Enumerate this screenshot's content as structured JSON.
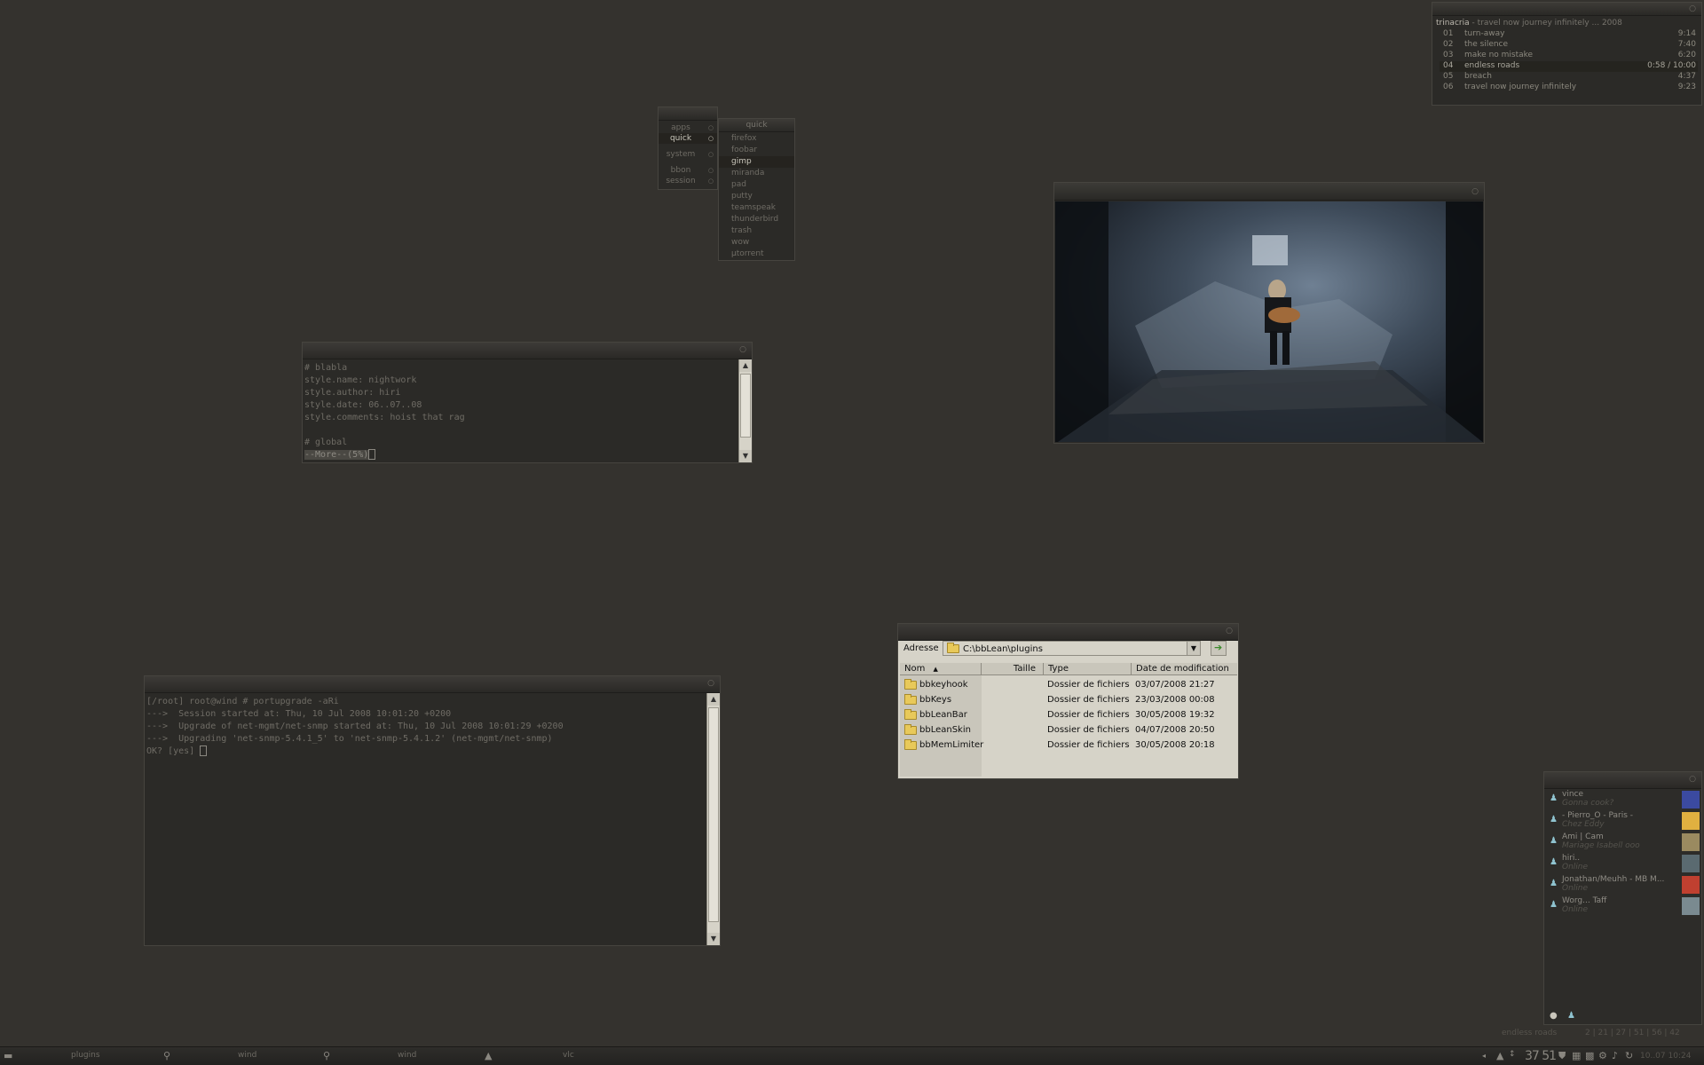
{
  "player": {
    "header_title": "trinacria",
    "header_sub": " - travel now journey infinitely ... 2008",
    "tracks": [
      {
        "num": "01",
        "title": "turn-away",
        "time": "9:14"
      },
      {
        "num": "02",
        "title": "the silence",
        "time": "7:40"
      },
      {
        "num": "03",
        "title": "make no mistake",
        "time": "6:20"
      },
      {
        "num": "04",
        "title": "endless roads",
        "time": "0:58 / 10:00"
      },
      {
        "num": "05",
        "title": "breach",
        "time": "4:37"
      },
      {
        "num": "06",
        "title": "travel now journey infinitely",
        "time": "9:23"
      }
    ]
  },
  "menu": {
    "items": [
      "apps",
      "quick",
      "system",
      "bbon",
      "session"
    ],
    "submenu_title": "quick",
    "submenu": [
      "firefox",
      "foobar",
      "gimp",
      "miranda",
      "pad",
      "putty",
      "teamspeak",
      "thunderbird",
      "trash",
      "wow",
      "µtorrent"
    ]
  },
  "pager": {
    "lines": [
      "# blabla",
      "style.name: nightwork",
      "style.author: hiri",
      "style.date: 06..07..08",
      "style.comments: hoist that rag",
      "",
      "# global"
    ],
    "more": "--More--(5%)"
  },
  "terminal": {
    "lines": [
      "[/root] root@wind # portupgrade -aRi",
      "--->  Session started at: Thu, 10 Jul 2008 10:01:20 +0200",
      "--->  Upgrade of net-mgmt/net-snmp started at: Thu, 10 Jul 2008 10:01:29 +0200",
      "--->  Upgrading 'net-snmp-5.4.1_5' to 'net-snmp-5.4.1.2' (net-mgmt/net-snmp)"
    ],
    "prompt": "OK? [yes] "
  },
  "explorer": {
    "address_label": "Adresse",
    "address_value": "C:\\bbLean\\plugins",
    "columns": {
      "name": "Nom",
      "size": "Taille",
      "type": "Type",
      "date": "Date de modification"
    },
    "rows": [
      {
        "name": "bbkeyhook",
        "type": "Dossier de fichiers",
        "date": "03/07/2008 21:27"
      },
      {
        "name": "bbKeys",
        "type": "Dossier de fichiers",
        "date": "23/03/2008 00:08"
      },
      {
        "name": "bbLeanBar",
        "type": "Dossier de fichiers",
        "date": "30/05/2008 19:32"
      },
      {
        "name": "bbLeanSkin",
        "type": "Dossier de fichiers",
        "date": "04/07/2008 20:50"
      },
      {
        "name": "bbMemLimiter",
        "type": "Dossier de fichiers",
        "date": "30/05/2008 20:18"
      }
    ]
  },
  "contacts": [
    {
      "name": "vince",
      "status": "Gonna cook?",
      "avatar_color": "#3b4aa0"
    },
    {
      "name": "- Pierro_O - Paris -",
      "status": "Chez Eddy",
      "avatar_color": "#e0b040"
    },
    {
      "name": "Ami | Cam",
      "status": "Mariage Isabell ooo",
      "avatar_color": "#9a8a60"
    },
    {
      "name": "hiri..",
      "status": "Online",
      "avatar_color": "#5a6a70"
    },
    {
      "name": "Jonathan/Meuhh - MB M...",
      "status": "Online",
      "avatar_color": "#c04030"
    },
    {
      "name": "Worg... Taff",
      "status": "Online",
      "avatar_color": "#7a8a90"
    }
  ],
  "tray": {
    "now_playing": "endless roads",
    "workspaces": "2 | 21 | 27 | 51 | 56 | 42",
    "numbers": "37 51",
    "clock": "10..07 10:24"
  },
  "taskbar": {
    "tasks": [
      "plugins",
      "wind",
      "wind",
      "vlc"
    ]
  }
}
